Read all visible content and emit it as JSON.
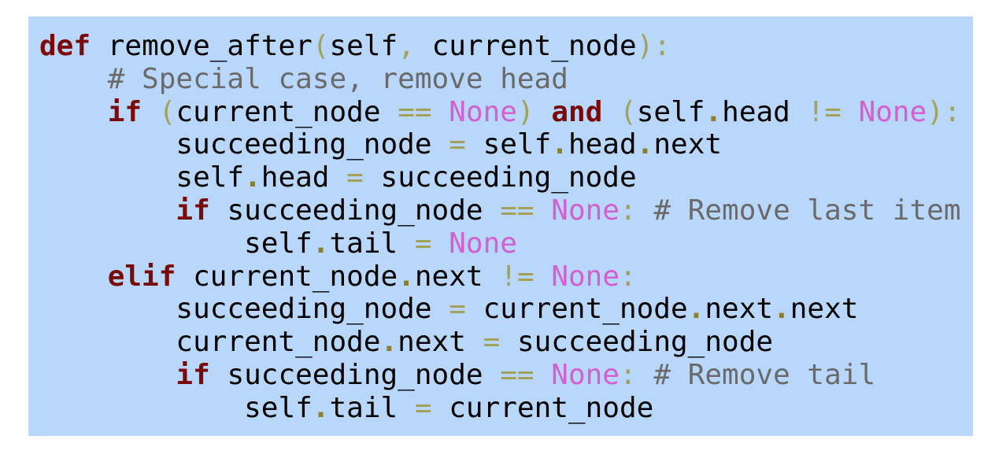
{
  "code": {
    "language": "python",
    "lines": [
      [
        {
          "t": "def",
          "c": "kw"
        },
        {
          "t": " ",
          "c": "ws"
        },
        {
          "t": "remove_after",
          "c": "name"
        },
        {
          "t": "(",
          "c": "op"
        },
        {
          "t": "self",
          "c": "name"
        },
        {
          "t": ",",
          "c": "op"
        },
        {
          "t": " ",
          "c": "ws"
        },
        {
          "t": "current_node",
          "c": "name"
        },
        {
          "t": "):",
          "c": "op"
        }
      ],
      [
        {
          "t": "    ",
          "c": "ws"
        },
        {
          "t": "# Special case, remove head",
          "c": "comment"
        }
      ],
      [
        {
          "t": "    ",
          "c": "ws"
        },
        {
          "t": "if",
          "c": "kw"
        },
        {
          "t": " ",
          "c": "ws"
        },
        {
          "t": "(",
          "c": "op"
        },
        {
          "t": "current_node",
          "c": "name"
        },
        {
          "t": " ",
          "c": "ws"
        },
        {
          "t": "==",
          "c": "op"
        },
        {
          "t": " ",
          "c": "ws"
        },
        {
          "t": "None",
          "c": "const"
        },
        {
          "t": ")",
          "c": "op"
        },
        {
          "t": " ",
          "c": "ws"
        },
        {
          "t": "and",
          "c": "kw"
        },
        {
          "t": " ",
          "c": "ws"
        },
        {
          "t": "(",
          "c": "op"
        },
        {
          "t": "self",
          "c": "name"
        },
        {
          "t": ".",
          "c": "dot"
        },
        {
          "t": "head",
          "c": "name"
        },
        {
          "t": " ",
          "c": "ws"
        },
        {
          "t": "!=",
          "c": "op"
        },
        {
          "t": " ",
          "c": "ws"
        },
        {
          "t": "None",
          "c": "const"
        },
        {
          "t": "):",
          "c": "op"
        }
      ],
      [
        {
          "t": "        ",
          "c": "ws"
        },
        {
          "t": "succeeding_node",
          "c": "name"
        },
        {
          "t": " ",
          "c": "ws"
        },
        {
          "t": "=",
          "c": "op"
        },
        {
          "t": " ",
          "c": "ws"
        },
        {
          "t": "self",
          "c": "name"
        },
        {
          "t": ".",
          "c": "dot"
        },
        {
          "t": "head",
          "c": "name"
        },
        {
          "t": ".",
          "c": "dot"
        },
        {
          "t": "next",
          "c": "name"
        }
      ],
      [
        {
          "t": "        ",
          "c": "ws"
        },
        {
          "t": "self",
          "c": "name"
        },
        {
          "t": ".",
          "c": "dot"
        },
        {
          "t": "head",
          "c": "name"
        },
        {
          "t": " ",
          "c": "ws"
        },
        {
          "t": "=",
          "c": "op"
        },
        {
          "t": " ",
          "c": "ws"
        },
        {
          "t": "succeeding_node",
          "c": "name"
        }
      ],
      [
        {
          "t": "        ",
          "c": "ws"
        },
        {
          "t": "if",
          "c": "kw"
        },
        {
          "t": " ",
          "c": "ws"
        },
        {
          "t": "succeeding_node",
          "c": "name"
        },
        {
          "t": " ",
          "c": "ws"
        },
        {
          "t": "==",
          "c": "op"
        },
        {
          "t": " ",
          "c": "ws"
        },
        {
          "t": "None",
          "c": "const"
        },
        {
          "t": ":",
          "c": "op"
        },
        {
          "t": " ",
          "c": "ws"
        },
        {
          "t": "# Remove last item",
          "c": "comment"
        }
      ],
      [
        {
          "t": "            ",
          "c": "ws"
        },
        {
          "t": "self",
          "c": "name"
        },
        {
          "t": ".",
          "c": "dot"
        },
        {
          "t": "tail",
          "c": "name"
        },
        {
          "t": " ",
          "c": "ws"
        },
        {
          "t": "=",
          "c": "op"
        },
        {
          "t": " ",
          "c": "ws"
        },
        {
          "t": "None",
          "c": "const"
        }
      ],
      [
        {
          "t": "    ",
          "c": "ws"
        },
        {
          "t": "elif",
          "c": "kw"
        },
        {
          "t": " ",
          "c": "ws"
        },
        {
          "t": "current_node",
          "c": "name"
        },
        {
          "t": ".",
          "c": "dot"
        },
        {
          "t": "next",
          "c": "name"
        },
        {
          "t": " ",
          "c": "ws"
        },
        {
          "t": "!=",
          "c": "op"
        },
        {
          "t": " ",
          "c": "ws"
        },
        {
          "t": "None",
          "c": "const"
        },
        {
          "t": ":",
          "c": "op"
        }
      ],
      [
        {
          "t": "        ",
          "c": "ws"
        },
        {
          "t": "succeeding_node",
          "c": "name"
        },
        {
          "t": " ",
          "c": "ws"
        },
        {
          "t": "=",
          "c": "op"
        },
        {
          "t": " ",
          "c": "ws"
        },
        {
          "t": "current_node",
          "c": "name"
        },
        {
          "t": ".",
          "c": "dot"
        },
        {
          "t": "next",
          "c": "name"
        },
        {
          "t": ".",
          "c": "dot"
        },
        {
          "t": "next",
          "c": "name"
        }
      ],
      [
        {
          "t": "        ",
          "c": "ws"
        },
        {
          "t": "current_node",
          "c": "name"
        },
        {
          "t": ".",
          "c": "dot"
        },
        {
          "t": "next",
          "c": "name"
        },
        {
          "t": " ",
          "c": "ws"
        },
        {
          "t": "=",
          "c": "op"
        },
        {
          "t": " ",
          "c": "ws"
        },
        {
          "t": "succeeding_node",
          "c": "name"
        }
      ],
      [
        {
          "t": "        ",
          "c": "ws"
        },
        {
          "t": "if",
          "c": "kw"
        },
        {
          "t": " ",
          "c": "ws"
        },
        {
          "t": "succeeding_node",
          "c": "name"
        },
        {
          "t": " ",
          "c": "ws"
        },
        {
          "t": "==",
          "c": "op"
        },
        {
          "t": " ",
          "c": "ws"
        },
        {
          "t": "None",
          "c": "const"
        },
        {
          "t": ":",
          "c": "op"
        },
        {
          "t": " ",
          "c": "ws"
        },
        {
          "t": "# Remove tail",
          "c": "comment"
        }
      ],
      [
        {
          "t": "            ",
          "c": "ws"
        },
        {
          "t": "self",
          "c": "name"
        },
        {
          "t": ".",
          "c": "dot"
        },
        {
          "t": "tail",
          "c": "name"
        },
        {
          "t": " ",
          "c": "ws"
        },
        {
          "t": "=",
          "c": "op"
        },
        {
          "t": " ",
          "c": "ws"
        },
        {
          "t": "current_node",
          "c": "name"
        }
      ]
    ]
  },
  "colors": {
    "background": "#b8d7fa",
    "keyword": "#7a0a0a",
    "constant": "#d35fd1",
    "operator": "#a3a15a",
    "dot": "#8c7e2a",
    "comment": "#6a6a6a",
    "text": "#000000"
  }
}
